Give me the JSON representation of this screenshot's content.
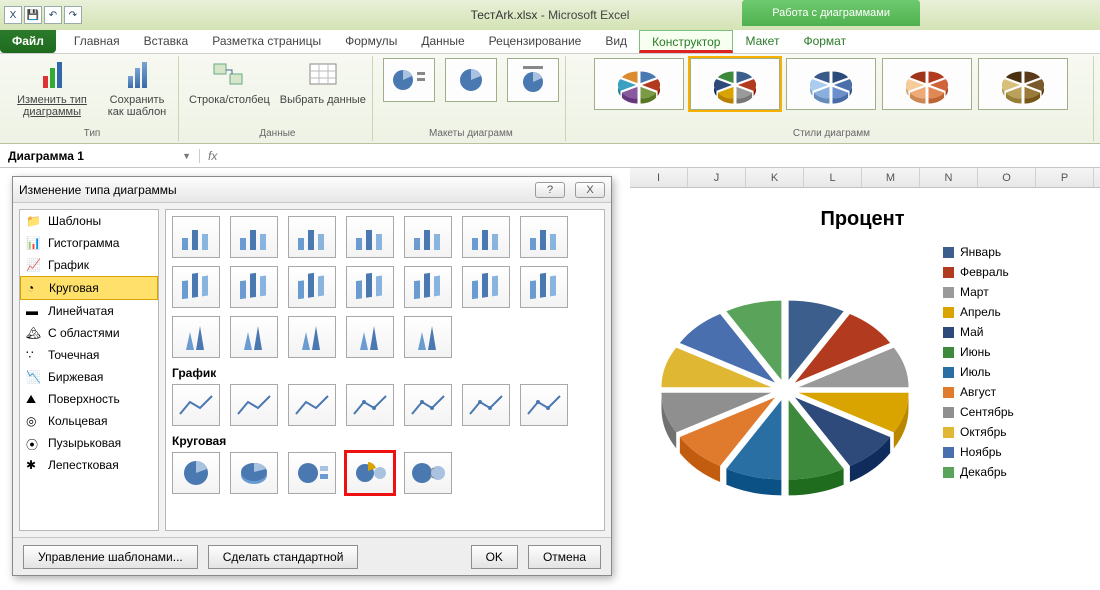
{
  "app": {
    "title_file": "ТестArk.xlsx",
    "title_app": "Microsoft Excel",
    "context_title": "Работа с диаграммами"
  },
  "tabs": {
    "file": "Файл",
    "items": [
      "Главная",
      "Вставка",
      "Разметка страницы",
      "Формулы",
      "Данные",
      "Рецензирование",
      "Вид"
    ],
    "context": [
      "Конструктор",
      "Макет",
      "Формат"
    ]
  },
  "ribbon": {
    "type_group": "Тип",
    "change_type": "Изменить тип диаграммы",
    "save_template": "Сохранить как шаблон",
    "data_group": "Данные",
    "switch_rowcol": "Строка/столбец",
    "select_data": "Выбрать данные",
    "layouts_group": "Макеты диаграмм",
    "styles_group": "Стили диаграмм"
  },
  "formula_bar": {
    "name": "Диаграмма 1",
    "fx": "fx"
  },
  "columns": [
    "I",
    "J",
    "K",
    "L",
    "M",
    "N",
    "O",
    "P"
  ],
  "dialog": {
    "title": "Изменение типа диаграммы",
    "help_icon": "?",
    "close_icon": "X",
    "categories": [
      "Шаблоны",
      "Гистограмма",
      "График",
      "Круговая",
      "Линейчатая",
      "С областями",
      "Точечная",
      "Биржевая",
      "Поверхность",
      "Кольцевая",
      "Пузырьковая",
      "Лепестковая"
    ],
    "selected_category_index": 3,
    "section_line": "График",
    "section_pie": "Круговая",
    "manage_templates": "Управление шаблонами...",
    "set_default": "Сделать стандартной",
    "ok": "OK",
    "cancel": "Отмена"
  },
  "chart": {
    "title": "Процент"
  },
  "chart_data": {
    "type": "pie",
    "title": "Процент",
    "categories": [
      "Январь",
      "Февраль",
      "Март",
      "Апрель",
      "Май",
      "Июнь",
      "Июль",
      "Август",
      "Сентябрь",
      "Октябрь",
      "Ноябрь",
      "Декабрь"
    ],
    "values": [
      8.3,
      8.3,
      8.3,
      8.3,
      8.3,
      8.3,
      8.3,
      8.3,
      8.3,
      8.3,
      8.3,
      8.3
    ],
    "colors": [
      "#3b5e8c",
      "#b23b1f",
      "#9a9a9a",
      "#d9a400",
      "#2e4a7a",
      "#3d8a3d",
      "#2a6fa3",
      "#e07b2e",
      "#8f8f8f",
      "#e0b733",
      "#4a6fae",
      "#5aa35a"
    ]
  }
}
